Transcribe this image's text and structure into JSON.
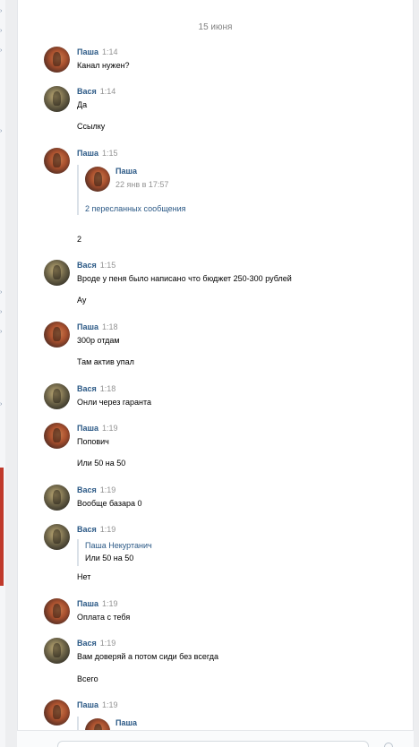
{
  "date_separator": "15 июня",
  "messages": [
    {
      "author": "Паша",
      "time": "1:14",
      "lines": [
        "Канал нужен?"
      ]
    },
    {
      "author": "Вася",
      "time": "1:14",
      "lines": [
        "Да",
        "Ссылку"
      ]
    },
    {
      "author": "Паша",
      "time": "1:15",
      "forward": {
        "name": "Паша",
        "date": "22 янв в 17:57",
        "link": "2 пересланных сообщения"
      },
      "lines": [
        "2"
      ]
    },
    {
      "author": "Вася",
      "time": "1:15",
      "lines": [
        "Вроде у пеня было написано что бюджет 250-300 рублей",
        "Ау"
      ]
    },
    {
      "author": "Паша",
      "time": "1:18",
      "lines": [
        "300р отдам",
        "Там актив упал"
      ]
    },
    {
      "author": "Вася",
      "time": "1:18",
      "lines": [
        "Онли через гаранта"
      ]
    },
    {
      "author": "Паша",
      "time": "1:19",
      "lines": [
        "Попович",
        "Или 50 на 50"
      ]
    },
    {
      "author": "Вася",
      "time": "1:19",
      "lines": [
        "Вообще базара 0"
      ]
    },
    {
      "author": "Вася",
      "time": "1:19",
      "quote": {
        "name": "Паша Некуртанич",
        "text": "Или 50 на 50"
      },
      "lines": [
        "Нет"
      ]
    },
    {
      "author": "Паша",
      "time": "1:19",
      "lines": [
        "Оплата с тебя"
      ]
    },
    {
      "author": "Вася",
      "time": "1:19",
      "lines": [
        "Вам доверяй а потом сиди без всегда",
        "Всего"
      ]
    },
    {
      "author": "Паша",
      "time": "1:19",
      "forward": {
        "name": "Паша"
      }
    }
  ],
  "left_marks": [
    "›",
    "›",
    "›",
    "›",
    "›",
    "›",
    "›",
    "›"
  ]
}
